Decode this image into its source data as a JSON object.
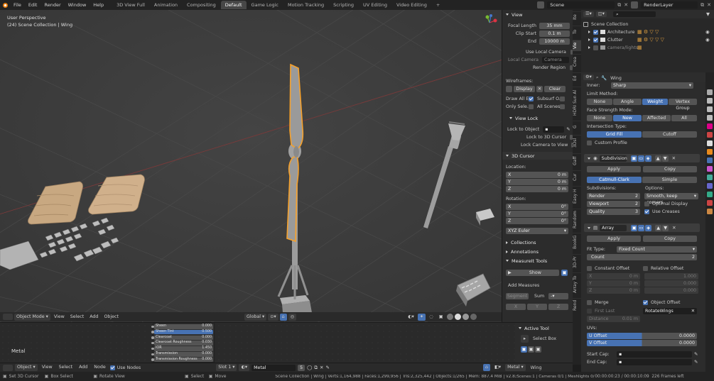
{
  "topbar": {
    "menus": [
      "File",
      "Edit",
      "Render",
      "Window",
      "Help"
    ],
    "workspaces": [
      "3D View Full",
      "Animation",
      "Compositing",
      "Default",
      "Game Logic",
      "Motion Tracking",
      "Scripting",
      "UV Editing",
      "Video Editing"
    ],
    "active_workspace": "Default",
    "add_tab": "+",
    "scene_name": "Scene",
    "render_layer": "RenderLayer"
  },
  "viewport": {
    "perspective": "User Perspective",
    "collection_info": "(24) Scene Collection | Wing",
    "header": {
      "mode": "Object Mode",
      "menus": [
        "View",
        "Select",
        "Add",
        "Object"
      ],
      "orientation": "Global"
    }
  },
  "npanel": {
    "tabs": [
      "Ite",
      "To",
      "Vie",
      "Crea",
      "Ed",
      "HDRI Sun Al",
      "G",
      "3Dsl",
      "Gaff",
      "Cur",
      "Easy H",
      "Random",
      "BookG",
      "3D-Pr",
      "Array To",
      "Rend"
    ],
    "view": {
      "title": "View",
      "focal_label": "Focal Length",
      "focal_value": "35 mm",
      "clip_start_label": "Clip Start",
      "clip_start_value": "0.1 m",
      "end_label": "End",
      "end_value": "10000 m",
      "use_local_camera": "Use Local Camera",
      "local_camera_label": "Local Camera",
      "local_camera_value": "Camera",
      "render_region": "Render Region",
      "wireframes": "Wireframes:",
      "display": "Display",
      "clear": "Clear",
      "draw_all": "Draw All E...",
      "subsurf": "Subsurf O...",
      "only_sele": "Only Sele...",
      "all_scenes": "All Scenes",
      "view_lock": "View Lock",
      "lock_to_object": "Lock to Object",
      "lock_3d_cursor": "Lock to 3D Cursor",
      "lock_camera": "Lock Camera to View"
    },
    "cursor": {
      "title": "3D Cursor",
      "location": "Location:",
      "x_label": "X",
      "x_value": "0 m",
      "y_label": "Y",
      "y_value": "0 m",
      "z_label": "Z",
      "z_value": "0 m",
      "rotation": "Rotation:",
      "rx_label": "X",
      "rx_value": "0°",
      "ry_label": "Y",
      "ry_value": "0°",
      "rz_label": "Z",
      "rz_value": "0°",
      "euler": "XYZ Euler"
    },
    "collections": "Collections",
    "annotations": "Annotations",
    "measureit": "MeasureIt Tools",
    "show": "Show",
    "add_measures": "Add Measures",
    "segment": "Segment",
    "sum": "Sum",
    "dash": "-",
    "x": "X",
    "y": "Y",
    "z": "Z"
  },
  "outliner": {
    "scene_collection": "Scene Collection",
    "items": [
      {
        "name": "Architecture"
      },
      {
        "name": "Clutter"
      },
      {
        "name": "camera/lights"
      }
    ]
  },
  "properties": {
    "object_name": "Wing",
    "inner_label": "Inner:",
    "inner_value": "Sharp",
    "limit_method": "Limit Method:",
    "limit_opts": [
      "None",
      "Angle",
      "Weight",
      "Vertex Group"
    ],
    "face_strength": "Face Strength Mode:",
    "face_opts": [
      "None",
      "New",
      "Affected",
      "All"
    ],
    "intersection": "Intersection Type:",
    "inter_opts": [
      "Grid Fill",
      "Cutoff"
    ],
    "custom_profile": "Custom Profile",
    "subdiv": {
      "name": "Subdivision",
      "apply": "Apply",
      "copy": "Copy",
      "catmull": "Catmull-Clark",
      "simple": "Simple",
      "subdivisions": "Subdivisions:",
      "options": "Options:",
      "render_label": "Render",
      "render_value": "2",
      "viewport_label": "Viewport",
      "viewport_value": "2",
      "quality_label": "Quality",
      "quality_value": "3",
      "smooth": "Smooth, keep corners",
      "optimal": "Optimal Display",
      "creases": "Use Creases"
    },
    "array": {
      "name": "Array",
      "apply": "Apply",
      "copy": "Copy",
      "fit_type_label": "Fit Type:",
      "fit_type_value": "Fixed Count",
      "count_label": "Count",
      "count_value": "2",
      "constant": "Constant Offset",
      "relative": "Relative Offset",
      "cx": "X",
      "cx_value": "0 m",
      "cy": "Y",
      "cy_value": "0 m",
      "cz": "Z",
      "cz_value": "0 m",
      "rx_value": "1.000",
      "ry_value": "0.000",
      "rz_value": "0.000",
      "merge": "Merge",
      "object_offset": "Object Offset",
      "first_last": "First Last",
      "offset_object": "RotateWings",
      "distance_label": "Distance",
      "distance_value": "0.01 m",
      "uvs": "UVs:",
      "u_label": "U Offset",
      "u_value": "0.0000",
      "v_label": "V Offset",
      "v_value": "0.0000",
      "start_cap": "Start Cap:",
      "end_cap": "End Cap:"
    }
  },
  "bottom": {
    "material_label": "Metal",
    "node_rows": [
      {
        "label": "Sheen",
        "value": "0.000"
      },
      {
        "label": "Sheen Tint",
        "value": "0.500"
      },
      {
        "label": "Clearcoat",
        "value": "0.000"
      },
      {
        "label": "Clearcoat Roughness",
        "value": "0.030"
      },
      {
        "label": "IOR",
        "value": "1.450"
      },
      {
        "label": "Transmission",
        "value": "0.000"
      },
      {
        "label": "Transmission Roughness",
        "value": "0.000"
      }
    ],
    "active_tool": "Active Tool",
    "select_box": "Select Box",
    "node_header": {
      "mode": "Object",
      "menus": [
        "View",
        "Select",
        "Add",
        "Node"
      ],
      "use_nodes": "Use Nodes",
      "slot": "Slot 1",
      "material": "Metal",
      "users": "5",
      "right_material": "Metal",
      "right_object": "Wing"
    }
  },
  "status": {
    "left1": "Set 3D Cursor",
    "left2": "Box Select",
    "left3": "Rotate View",
    "mid1": "Select",
    "mid2": "Move",
    "stats": "Scene Collection | Wing | Verts:1,164,988 | Faces:1,299,956 | Tris:2,325,442 | Objects:1/265 | Mem: 887.4 MiB | v2.83.13",
    "render": "Scenes:1 | Cameras 0/1 | Meshlights 0/0",
    "time": "00:00:00:23 / 00:00:10:09",
    "frames": "226 Frames left"
  }
}
